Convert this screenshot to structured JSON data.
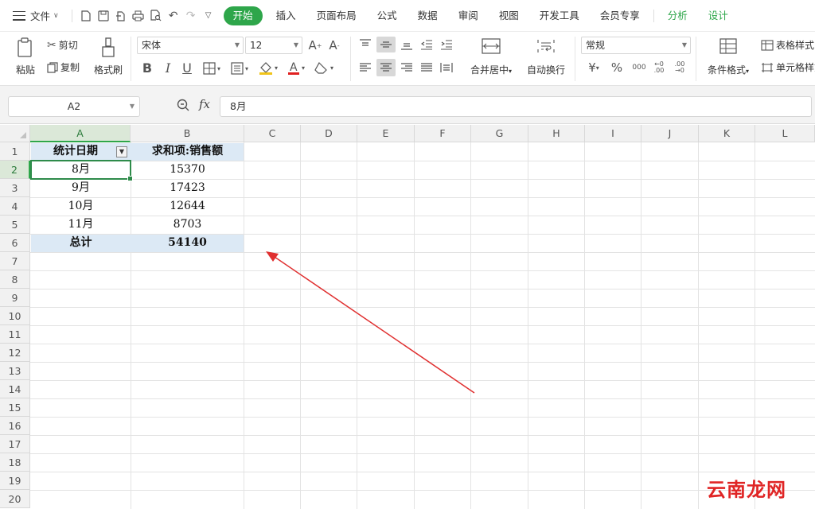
{
  "menubar": {
    "file_label": "文件",
    "tabs": [
      {
        "label": "开始",
        "active": true
      },
      {
        "label": "插入"
      },
      {
        "label": "页面布局"
      },
      {
        "label": "公式"
      },
      {
        "label": "数据"
      },
      {
        "label": "审阅"
      },
      {
        "label": "视图"
      },
      {
        "label": "开发工具"
      },
      {
        "label": "会员专享"
      },
      {
        "label": "分析"
      },
      {
        "label": "设计"
      }
    ]
  },
  "ribbon": {
    "paste": "粘贴",
    "cut": "剪切",
    "copy": "复制",
    "format_painter": "格式刷",
    "font_name": "宋体",
    "font_size": "12",
    "merge_center": "合并居中",
    "wrap_text": "自动换行",
    "number_format": "常规",
    "conditional_format": "条件格式",
    "table_style": "表格样式",
    "cell_style": "单元格样式"
  },
  "formula_bar": {
    "cell_ref": "A2",
    "formula": "8月"
  },
  "grid": {
    "columns": [
      "A",
      "B",
      "C",
      "D",
      "E",
      "F",
      "G",
      "H",
      "I",
      "J",
      "K",
      "L"
    ],
    "rows": [
      "1",
      "2",
      "3",
      "4",
      "5",
      "6",
      "7",
      "8",
      "9",
      "10",
      "11",
      "12",
      "13",
      "14",
      "15",
      "16",
      "17",
      "18",
      "19",
      "20"
    ],
    "pivot": {
      "header_date": "统计日期",
      "header_sum": "求和项:销售额",
      "data": [
        {
          "month": "8月",
          "value": "15370"
        },
        {
          "month": "9月",
          "value": "17423"
        },
        {
          "month": "10月",
          "value": "12644"
        },
        {
          "month": "11月",
          "value": "8703"
        }
      ],
      "total_label": "总计",
      "total_value": "54140"
    }
  },
  "annotation": {
    "arrow_color": "#e03030"
  },
  "watermark": "云南龙网",
  "colors": {
    "accent": "#2ea64a",
    "pivot_fill": "#dce9f5"
  }
}
